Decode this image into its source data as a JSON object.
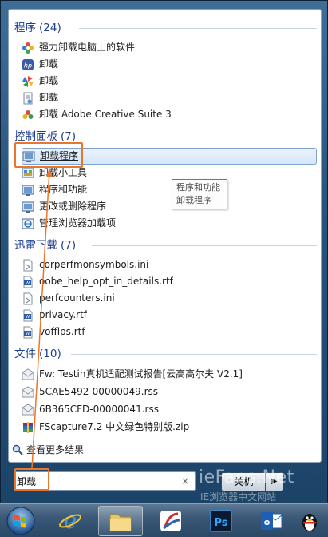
{
  "groups": [
    {
      "title": "程序",
      "count": "(24)",
      "items": [
        {
          "label": "强力卸载电脑上的软件",
          "icon": "flower-app-icon"
        },
        {
          "label": "卸载",
          "icon": "hp-app-icon"
        },
        {
          "label": "卸载",
          "icon": "pinwheel-app-icon"
        },
        {
          "label": "卸载",
          "icon": "document-app-icon"
        },
        {
          "label": "卸载 Adobe Creative Suite 3",
          "icon": "adobe-cs3-icon"
        }
      ]
    },
    {
      "title": "控制面板",
      "count": "(7)",
      "items": [
        {
          "label": "卸载程序",
          "icon": "programs-features-icon"
        },
        {
          "label": "卸载小工具",
          "icon": "gadgets-icon"
        },
        {
          "label": "程序和功能",
          "icon": "programs-features-icon"
        },
        {
          "label": "更改或删除程序",
          "icon": "programs-features-icon"
        },
        {
          "label": "管理浏览器加载项",
          "icon": "internet-options-icon"
        }
      ]
    },
    {
      "title": "迅雷下载",
      "count": "(7)",
      "items": [
        {
          "label": "corperfmonsymbols.ini",
          "icon": "ini-file-icon"
        },
        {
          "label": "oobe_help_opt_in_details.rtf",
          "icon": "rtf-file-icon"
        },
        {
          "label": "perfcounters.ini",
          "icon": "ini-file-icon"
        },
        {
          "label": "privacy.rtf",
          "icon": "rtf-file-icon"
        },
        {
          "label": "vofflps.rtf",
          "icon": "rtf-file-icon"
        }
      ]
    },
    {
      "title": "文件",
      "count": "(10)",
      "items": [
        {
          "label": "Fw: Testin真机适配测试报告[云高高尔夫 V2.1]",
          "icon": "email-icon"
        },
        {
          "label": "5CAE5492-00000049.rss",
          "icon": "email-icon"
        },
        {
          "label": "6B365CFD-00000041.rss",
          "icon": "email-icon"
        },
        {
          "label": "FScapture7.2 中文绿色特别版.zip",
          "icon": "zip-archive-icon"
        }
      ]
    }
  ],
  "tooltip": {
    "line1": "程序和功能",
    "line2": "卸载程序"
  },
  "more_results": "查看更多结果",
  "search": {
    "value": "卸载",
    "clear": "×"
  },
  "shutdown": {
    "label": "关机",
    "arrow": "▶"
  },
  "watermark": {
    "logo": "ieFans.Net",
    "sub": "IE浏览器中文网站"
  },
  "taskbar": {
    "items": [
      {
        "icon": "windows-start-orb-icon"
      },
      {
        "icon": "internet-explorer-icon"
      },
      {
        "icon": "file-explorer-icon"
      },
      {
        "icon": "media-app-icon"
      },
      {
        "icon": "photoshop-icon",
        "text": "Ps"
      },
      {
        "icon": "outlook-icon",
        "text": "o"
      },
      {
        "icon": "qq-penguin-icon"
      }
    ]
  },
  "colors": {
    "accent_highlight": "#e9762b",
    "group_header": "#1e3e8c",
    "selection": "#d5e7fb"
  }
}
